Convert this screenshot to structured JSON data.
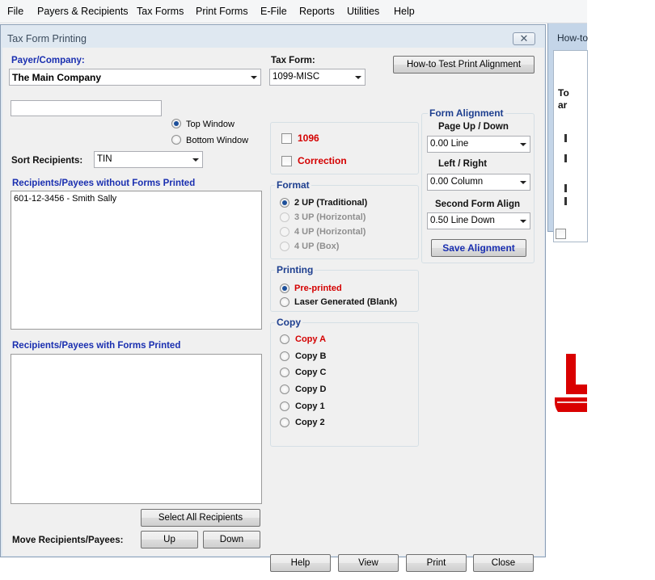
{
  "menu": [
    "File",
    "Payers & Recipients",
    "Tax Forms",
    "Print Forms",
    "E-File",
    "Reports",
    "Utilities",
    "Help"
  ],
  "background_window": {
    "title": "How-to",
    "text_fragments": [
      "To",
      "ar"
    ]
  },
  "dialog": {
    "title": "Tax Form Printing",
    "close_glyph": "✕"
  },
  "payer": {
    "label": "Payer/Company:",
    "value": "The Main Company"
  },
  "tax_form": {
    "label": "Tax Form:",
    "value": "1099-MISC"
  },
  "howto_button": "How-to Test Print  Alignment",
  "window_position": {
    "options": [
      "Top Window",
      "Bottom Window"
    ],
    "selected": "Top Window"
  },
  "sort": {
    "label": "Sort Recipients:",
    "value": "TIN"
  },
  "without_forms": {
    "label": "Recipients/Payees without Forms Printed",
    "items": [
      "601-12-3456 - Smith  Sally"
    ]
  },
  "with_forms": {
    "label": "Recipients/Payees with Forms Printed",
    "items": []
  },
  "select_all_button": "Select All Recipients",
  "move": {
    "label": "Move Recipients/Payees:",
    "up": "Up",
    "down": "Down"
  },
  "checks": {
    "form_1096": "1096",
    "correction": "Correction"
  },
  "format": {
    "title": "Format",
    "options": [
      "2 UP (Traditional)",
      "3 UP (Horizontal)",
      "4 UP (Horizontal)",
      "4 UP (Box)"
    ],
    "selected": "2 UP (Traditional)"
  },
  "printing": {
    "title": "Printing",
    "options": [
      "Pre-printed",
      "Laser Generated (Blank)"
    ],
    "selected": "Pre-printed"
  },
  "copy": {
    "title": "Copy",
    "options": [
      "Copy A",
      "Copy B",
      "Copy C",
      "Copy D",
      "Copy 1",
      "Copy 2"
    ]
  },
  "alignment": {
    "title": "Form Alignment",
    "page_label": "Page Up / Down",
    "page_value": "0.00 Line",
    "lr_label": "Left / Right",
    "lr_value": "0.00 Column",
    "second_label": "Second Form Align",
    "second_value": "0.50 Line Down",
    "save_button": "Save  Alignment"
  },
  "buttons": {
    "help": "Help",
    "view": "View",
    "print": "Print",
    "close": "Close"
  },
  "colors": {
    "label_blue": "#1a2fb0",
    "alert_red": "#d40000",
    "group_title": "#1e3f8f",
    "logo_red": "#d90000"
  }
}
